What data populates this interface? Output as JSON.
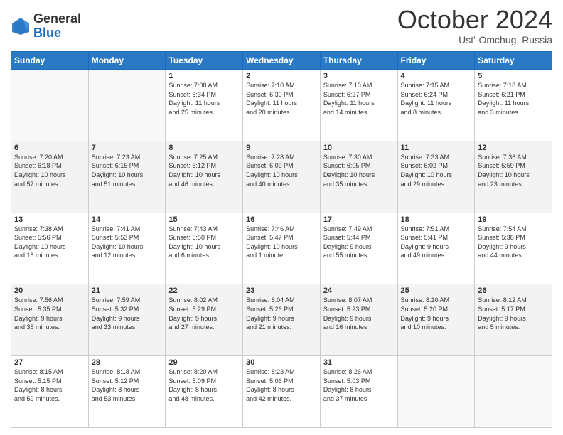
{
  "logo": {
    "general": "General",
    "blue": "Blue"
  },
  "header": {
    "month": "October 2024",
    "location": "Ust'-Omchug, Russia"
  },
  "weekdays": [
    "Sunday",
    "Monday",
    "Tuesday",
    "Wednesday",
    "Thursday",
    "Friday",
    "Saturday"
  ],
  "weeks": [
    [
      {
        "day": "",
        "text": ""
      },
      {
        "day": "",
        "text": ""
      },
      {
        "day": "1",
        "text": "Sunrise: 7:08 AM\nSunset: 6:34 PM\nDaylight: 11 hours\nand 25 minutes."
      },
      {
        "day": "2",
        "text": "Sunrise: 7:10 AM\nSunset: 6:30 PM\nDaylight: 11 hours\nand 20 minutes."
      },
      {
        "day": "3",
        "text": "Sunrise: 7:13 AM\nSunset: 6:27 PM\nDaylight: 11 hours\nand 14 minutes."
      },
      {
        "day": "4",
        "text": "Sunrise: 7:15 AM\nSunset: 6:24 PM\nDaylight: 11 hours\nand 8 minutes."
      },
      {
        "day": "5",
        "text": "Sunrise: 7:18 AM\nSunset: 6:21 PM\nDaylight: 11 hours\nand 3 minutes."
      }
    ],
    [
      {
        "day": "6",
        "text": "Sunrise: 7:20 AM\nSunset: 6:18 PM\nDaylight: 10 hours\nand 57 minutes."
      },
      {
        "day": "7",
        "text": "Sunrise: 7:23 AM\nSunset: 6:15 PM\nDaylight: 10 hours\nand 51 minutes."
      },
      {
        "day": "8",
        "text": "Sunrise: 7:25 AM\nSunset: 6:12 PM\nDaylight: 10 hours\nand 46 minutes."
      },
      {
        "day": "9",
        "text": "Sunrise: 7:28 AM\nSunset: 6:09 PM\nDaylight: 10 hours\nand 40 minutes."
      },
      {
        "day": "10",
        "text": "Sunrise: 7:30 AM\nSunset: 6:05 PM\nDaylight: 10 hours\nand 35 minutes."
      },
      {
        "day": "11",
        "text": "Sunrise: 7:33 AM\nSunset: 6:02 PM\nDaylight: 10 hours\nand 29 minutes."
      },
      {
        "day": "12",
        "text": "Sunrise: 7:36 AM\nSunset: 5:59 PM\nDaylight: 10 hours\nand 23 minutes."
      }
    ],
    [
      {
        "day": "13",
        "text": "Sunrise: 7:38 AM\nSunset: 5:56 PM\nDaylight: 10 hours\nand 18 minutes."
      },
      {
        "day": "14",
        "text": "Sunrise: 7:41 AM\nSunset: 5:53 PM\nDaylight: 10 hours\nand 12 minutes."
      },
      {
        "day": "15",
        "text": "Sunrise: 7:43 AM\nSunset: 5:50 PM\nDaylight: 10 hours\nand 6 minutes."
      },
      {
        "day": "16",
        "text": "Sunrise: 7:46 AM\nSunset: 5:47 PM\nDaylight: 10 hours\nand 1 minute."
      },
      {
        "day": "17",
        "text": "Sunrise: 7:49 AM\nSunset: 5:44 PM\nDaylight: 9 hours\nand 55 minutes."
      },
      {
        "day": "18",
        "text": "Sunrise: 7:51 AM\nSunset: 5:41 PM\nDaylight: 9 hours\nand 49 minutes."
      },
      {
        "day": "19",
        "text": "Sunrise: 7:54 AM\nSunset: 5:38 PM\nDaylight: 9 hours\nand 44 minutes."
      }
    ],
    [
      {
        "day": "20",
        "text": "Sunrise: 7:56 AM\nSunset: 5:35 PM\nDaylight: 9 hours\nand 38 minutes."
      },
      {
        "day": "21",
        "text": "Sunrise: 7:59 AM\nSunset: 5:32 PM\nDaylight: 9 hours\nand 33 minutes."
      },
      {
        "day": "22",
        "text": "Sunrise: 8:02 AM\nSunset: 5:29 PM\nDaylight: 9 hours\nand 27 minutes."
      },
      {
        "day": "23",
        "text": "Sunrise: 8:04 AM\nSunset: 5:26 PM\nDaylight: 9 hours\nand 21 minutes."
      },
      {
        "day": "24",
        "text": "Sunrise: 8:07 AM\nSunset: 5:23 PM\nDaylight: 9 hours\nand 16 minutes."
      },
      {
        "day": "25",
        "text": "Sunrise: 8:10 AM\nSunset: 5:20 PM\nDaylight: 9 hours\nand 10 minutes."
      },
      {
        "day": "26",
        "text": "Sunrise: 8:12 AM\nSunset: 5:17 PM\nDaylight: 9 hours\nand 5 minutes."
      }
    ],
    [
      {
        "day": "27",
        "text": "Sunrise: 8:15 AM\nSunset: 5:15 PM\nDaylight: 8 hours\nand 59 minutes."
      },
      {
        "day": "28",
        "text": "Sunrise: 8:18 AM\nSunset: 5:12 PM\nDaylight: 8 hours\nand 53 minutes."
      },
      {
        "day": "29",
        "text": "Sunrise: 8:20 AM\nSunset: 5:09 PM\nDaylight: 8 hours\nand 48 minutes."
      },
      {
        "day": "30",
        "text": "Sunrise: 8:23 AM\nSunset: 5:06 PM\nDaylight: 8 hours\nand 42 minutes."
      },
      {
        "day": "31",
        "text": "Sunrise: 8:26 AM\nSunset: 5:03 PM\nDaylight: 8 hours\nand 37 minutes."
      },
      {
        "day": "",
        "text": ""
      },
      {
        "day": "",
        "text": ""
      }
    ]
  ]
}
